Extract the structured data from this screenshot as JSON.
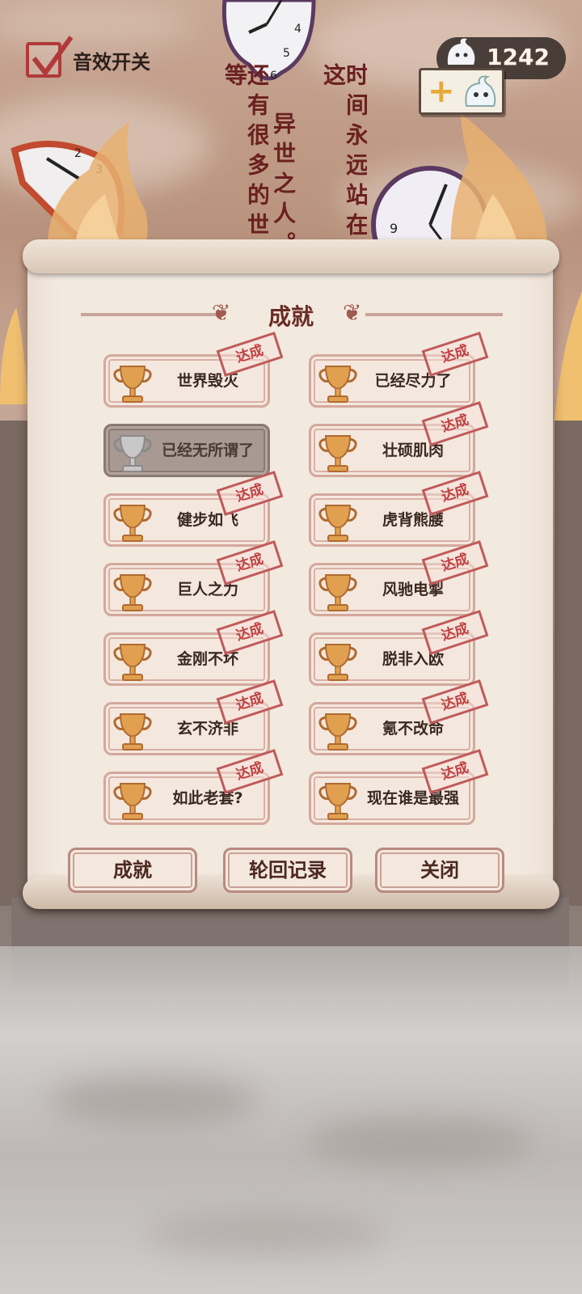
{
  "settings": {
    "sound_label": "音效开关",
    "sound_enabled": true
  },
  "currency": {
    "amount": "1242",
    "icon": "ghost-icon",
    "add_icon": "plus-icon"
  },
  "story": {
    "column_left": "还有很多的世界等",
    "column_mid": "异世之人。",
    "column_right": "时间永远站在你这"
  },
  "panel": {
    "title": "成就",
    "achievements": [
      {
        "name": "世界毁灭",
        "status": "达成",
        "unlocked": true
      },
      {
        "name": "已经尽力了",
        "status": "达成",
        "unlocked": true
      },
      {
        "name": "已经无所谓了",
        "status": "",
        "unlocked": false
      },
      {
        "name": "壮硕肌肉",
        "status": "达成",
        "unlocked": true
      },
      {
        "name": "健步如飞",
        "status": "达成",
        "unlocked": true
      },
      {
        "name": "虎背熊腰",
        "status": "达成",
        "unlocked": true
      },
      {
        "name": "巨人之力",
        "status": "达成",
        "unlocked": true
      },
      {
        "name": "风驰电掣",
        "status": "达成",
        "unlocked": true
      },
      {
        "name": "金刚不坏",
        "status": "达成",
        "unlocked": true
      },
      {
        "name": "脱非入欧",
        "status": "达成",
        "unlocked": true
      },
      {
        "name": "玄不济非",
        "status": "达成",
        "unlocked": true
      },
      {
        "name": "氪不改命",
        "status": "达成",
        "unlocked": true
      },
      {
        "name": "如此老套?",
        "status": "达成",
        "unlocked": true
      },
      {
        "name": "现在谁是最强",
        "status": "达成",
        "unlocked": true
      }
    ],
    "buttons": {
      "achievements": "成就",
      "history": "轮回记录",
      "close": "关闭"
    }
  },
  "colors": {
    "stamp": "#c04040",
    "trophy_gold": "#e0a050",
    "trophy_locked": "#c8c8c8",
    "text_red": "#6a2020"
  }
}
